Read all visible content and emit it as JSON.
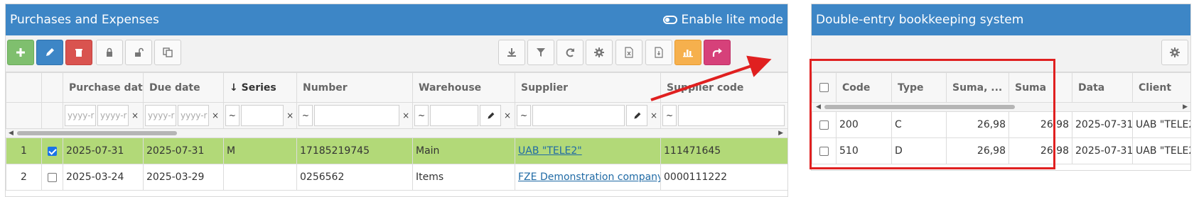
{
  "left": {
    "title": "Purchases and Expenses",
    "lite_mode_label": "Enable lite mode",
    "toolbar_left": [
      "add",
      "edit",
      "delete",
      "lock",
      "unlock",
      "copy"
    ],
    "toolbar_right": [
      "download",
      "filter",
      "refresh",
      "settings",
      "excel",
      "pdf",
      "chart",
      "share"
    ],
    "columns": [
      "Purchase date",
      "Due date",
      "Series",
      "Number",
      "Warehouse",
      "Supplier",
      "Supplier code"
    ],
    "sort_indicator": "↓",
    "filter_placeholder": "yyyy-r",
    "filter_placeholder_due": "yyyy-r",
    "filter_tilde": "~",
    "filter_x": "×",
    "rows": [
      {
        "index": "1",
        "checked": true,
        "purchase_date": "2025-07-31",
        "due_date": "2025-07-31",
        "series": "M",
        "number": "17185219745",
        "warehouse": "Main",
        "supplier": "UAB \"TELE2\"",
        "supplier_code": "111471645"
      },
      {
        "index": "2",
        "checked": false,
        "purchase_date": "2025-03-24",
        "due_date": "2025-03-29",
        "series": "",
        "number": "0256562",
        "warehouse": "Items",
        "supplier": "FZE Demonstration company",
        "supplier_code": "0000111222"
      }
    ]
  },
  "right": {
    "title": "Double-entry bookkeeping system",
    "columns": [
      "Code",
      "Type",
      "Suma, ...",
      "Suma",
      "Data",
      "Client"
    ],
    "rows": [
      {
        "code": "200",
        "type": "C",
        "suma1": "26,98",
        "suma2": "26,98",
        "data": "2025-07-31",
        "client": "UAB \"TELE2"
      },
      {
        "code": "510",
        "type": "D",
        "suma1": "26,98",
        "suma2": "26,98",
        "data": "2025-07-31",
        "client": "UAB \"TELE2"
      }
    ]
  },
  "colors": {
    "header": "#3d86c6",
    "selected_row": "#b2d978",
    "highlight": "#e02020",
    "link": "#1f6aa5"
  }
}
